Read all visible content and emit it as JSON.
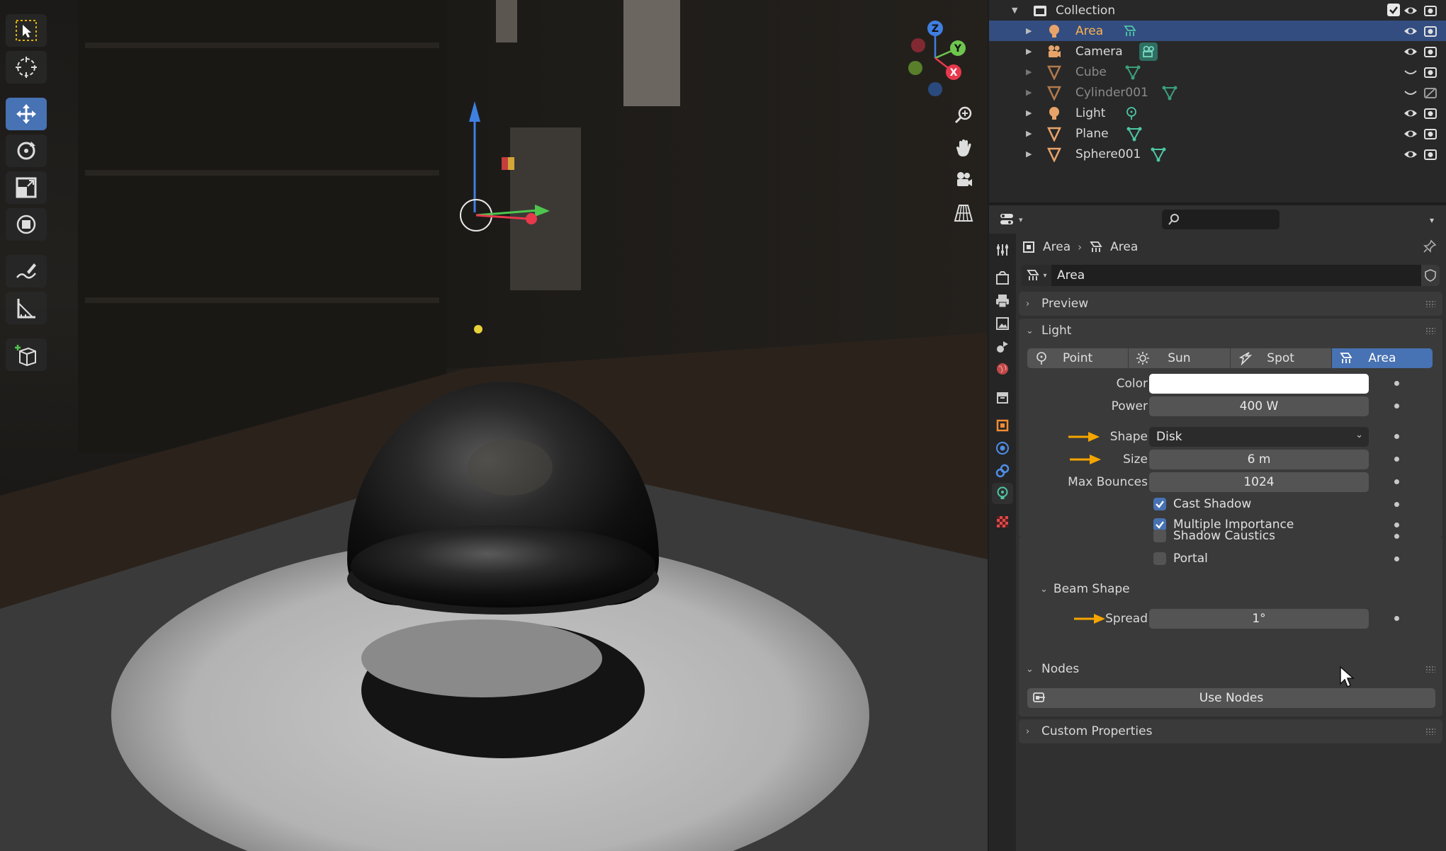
{
  "outliner": {
    "collection": "Collection",
    "items": [
      {
        "label": "Area",
        "type": "light",
        "selected": true
      },
      {
        "label": "Camera",
        "type": "camera"
      },
      {
        "label": "Cube",
        "type": "mesh",
        "hidden": true
      },
      {
        "label": "Cylinder001",
        "type": "mesh",
        "hidden": true
      },
      {
        "label": "Light",
        "type": "light"
      },
      {
        "label": "Plane",
        "type": "mesh"
      },
      {
        "label": "Sphere001",
        "type": "mesh"
      }
    ]
  },
  "properties": {
    "breadcrumb": [
      "Area",
      "Area"
    ],
    "datablock_name": "Area",
    "panels": {
      "preview": "Preview",
      "light": "Light",
      "beam_shape": "Beam Shape",
      "nodes": "Nodes",
      "custom_properties": "Custom Properties"
    },
    "light_types": [
      "Point",
      "Sun",
      "Spot",
      "Area"
    ],
    "active_light_type": "Area",
    "fields": {
      "color_label": "Color",
      "power_label": "Power",
      "power_value": "400 W",
      "shape_label": "Shape",
      "shape_value": "Disk",
      "size_label": "Size",
      "size_value": "6 m",
      "max_bounces_label": "Max Bounces",
      "max_bounces_value": "1024",
      "spread_label": "Spread",
      "spread_value": "1°"
    },
    "checkboxes": [
      {
        "label": "Cast Shadow",
        "checked": true
      },
      {
        "label": "Multiple Importance",
        "checked": true
      },
      {
        "label": "Shadow Caustics",
        "checked": false
      },
      {
        "label": "Portal",
        "checked": false
      }
    ],
    "use_nodes": "Use Nodes"
  },
  "colors": {
    "accent": "#4772b3",
    "selected_row": "#334d80",
    "highlight_text": "#ffb24a",
    "annotation_arrow": "#f5a500",
    "light_color": "#ffffff"
  },
  "gizmo_axes": [
    "Z",
    "Y",
    "X"
  ]
}
